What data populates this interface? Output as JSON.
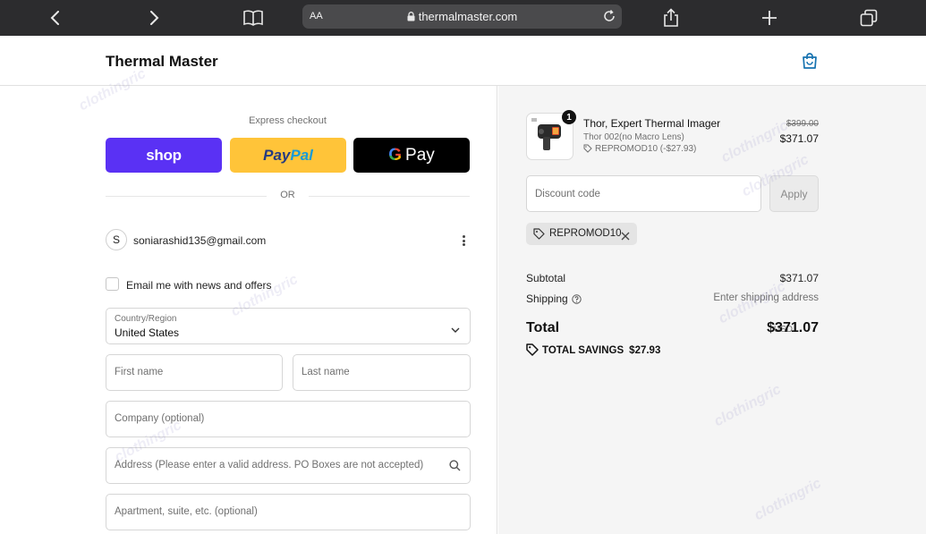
{
  "browser": {
    "aa_label": "AA",
    "url": "thermalmaster.com",
    "icons": [
      "back-icon",
      "forward-icon",
      "book-icon",
      "lock-icon",
      "reload-icon",
      "share-icon",
      "plus-icon",
      "tabs-icon"
    ]
  },
  "header": {
    "store_name": "Thermal Master",
    "cart_icon": "shopping-bag-icon"
  },
  "checkout": {
    "express_label": "Express checkout",
    "shop_label": "shop",
    "paypal_part1": "Pay",
    "paypal_part2": "Pal",
    "gpay_g": "G",
    "gpay_label": "Pay",
    "or_label": "OR",
    "avatar_initial": "S",
    "email": "soniarashid135@gmail.com",
    "news_label": "Email me with news and offers",
    "country_label": "Country/Region",
    "country_value": "United States",
    "first_name_placeholder": "First name",
    "last_name_placeholder": "Last name",
    "company_placeholder": "Company (optional)",
    "address_placeholder": "Address (Please enter a valid address. PO Boxes are not accepted)",
    "apartment_placeholder": "Apartment, suite, etc. (optional)"
  },
  "summary": {
    "item": {
      "quantity": "1",
      "title": "Thor, Expert Thermal Imager",
      "variant": "Thor 002(no Macro Lens)",
      "discount": "REPROMOD10 (-$27.93)",
      "original_price": "$399.00",
      "price": "$371.07"
    },
    "discount_placeholder": "Discount code",
    "apply_label": "Apply",
    "applied_code": "REPROMOD10",
    "subtotal_label": "Subtotal",
    "subtotal_value": "$371.07",
    "shipping_label": "Shipping",
    "shipping_value": "Enter shipping address",
    "total_label": "Total",
    "total_currency": "USD",
    "total_value": "$371.07",
    "savings_label": "TOTAL SAVINGS",
    "savings_value": "$27.93"
  },
  "watermark_text": "clothingric",
  "colors": {
    "shop_purple": "#5a31f4",
    "paypal_yellow": "#ffc439",
    "gpay_black": "#000000",
    "summary_bg": "#f5f5f5",
    "link_blue": "#1773b0"
  }
}
